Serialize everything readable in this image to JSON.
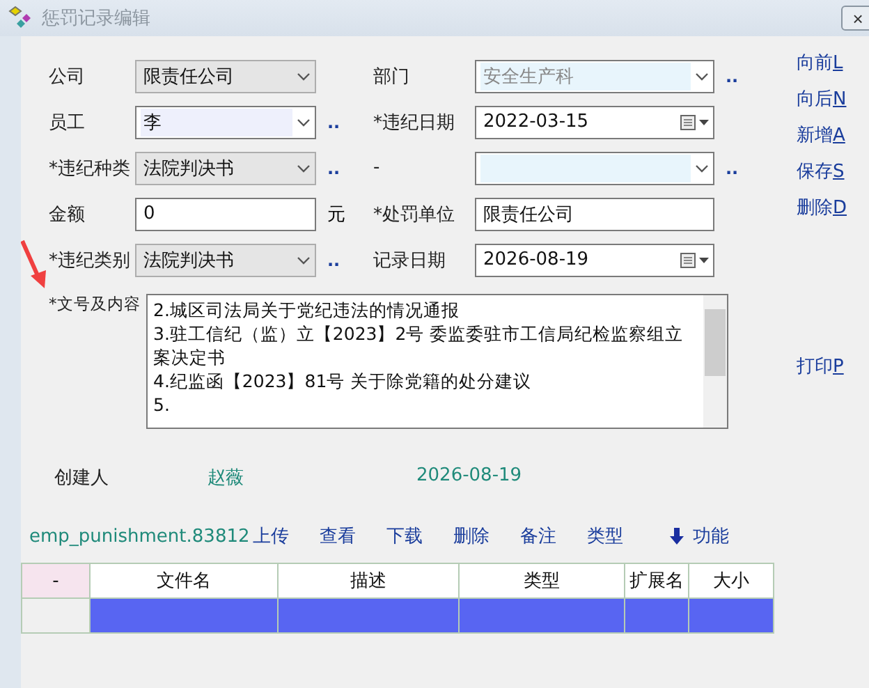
{
  "window": {
    "title": "惩罚记录编辑",
    "close": "×"
  },
  "form": {
    "rows": [
      [
        {
          "label": "公司",
          "kind": "select",
          "value": "限责任公司"
        },
        {
          "label": "部门",
          "kind": "combo",
          "value": "安全生产科",
          "disabled": true,
          "lookup": ".."
        }
      ],
      [
        {
          "label": "员工",
          "kind": "combo",
          "value": "李",
          "lookup": ".."
        },
        {
          "label": "*违纪日期",
          "kind": "date",
          "value": "2022-03-15"
        }
      ],
      [
        {
          "label": "*违纪种类",
          "kind": "select",
          "value": "法院判决书",
          "lookup": ".."
        },
        {
          "label": "-",
          "kind": "combo",
          "lookup": ".."
        }
      ],
      [
        {
          "label": "金额",
          "kind": "input",
          "value": "0",
          "unit": "元"
        },
        {
          "label": "*处罚单位",
          "kind": "input",
          "value": "限责任公司"
        }
      ],
      [
        {
          "label": "*违纪类别",
          "kind": "select",
          "value": "法院判决书",
          "lookup": ".."
        },
        {
          "label": "记录日期",
          "kind": "date",
          "value": "2026-08-19"
        }
      ]
    ],
    "content": {
      "label": "*文号及内容",
      "lines": [
        "2.城区司法局关于党纪违法的情况通报",
        "3.驻工信纪（监）立【2023】2号 委监委驻市工信局纪检监察组立案决定书",
        "4.纪监函【2023】81号  关于除党籍的处分建议",
        "5."
      ]
    }
  },
  "actions": [
    {
      "label": "向前",
      "key": "L"
    },
    {
      "label": "向后",
      "key": "N"
    },
    {
      "label": "新增",
      "key": "A"
    },
    {
      "label": "保存",
      "key": "S"
    },
    {
      "label": "删除",
      "key": "D"
    }
  ],
  "print_action": {
    "label": "打印",
    "key": "P"
  },
  "creator": {
    "label": "创建人",
    "name": "赵薇",
    "date": "2026-08-19"
  },
  "attachments": {
    "record_id": "emp_punishment.83812",
    "buttons": [
      "上传",
      "查看",
      "下载",
      "删除",
      "备注",
      "类型"
    ],
    "menu": "功能",
    "columns": [
      "-",
      "文件名",
      "描述",
      "类型",
      "扩展名",
      "大小"
    ],
    "rows": [
      {
        "selected": true
      }
    ]
  }
}
